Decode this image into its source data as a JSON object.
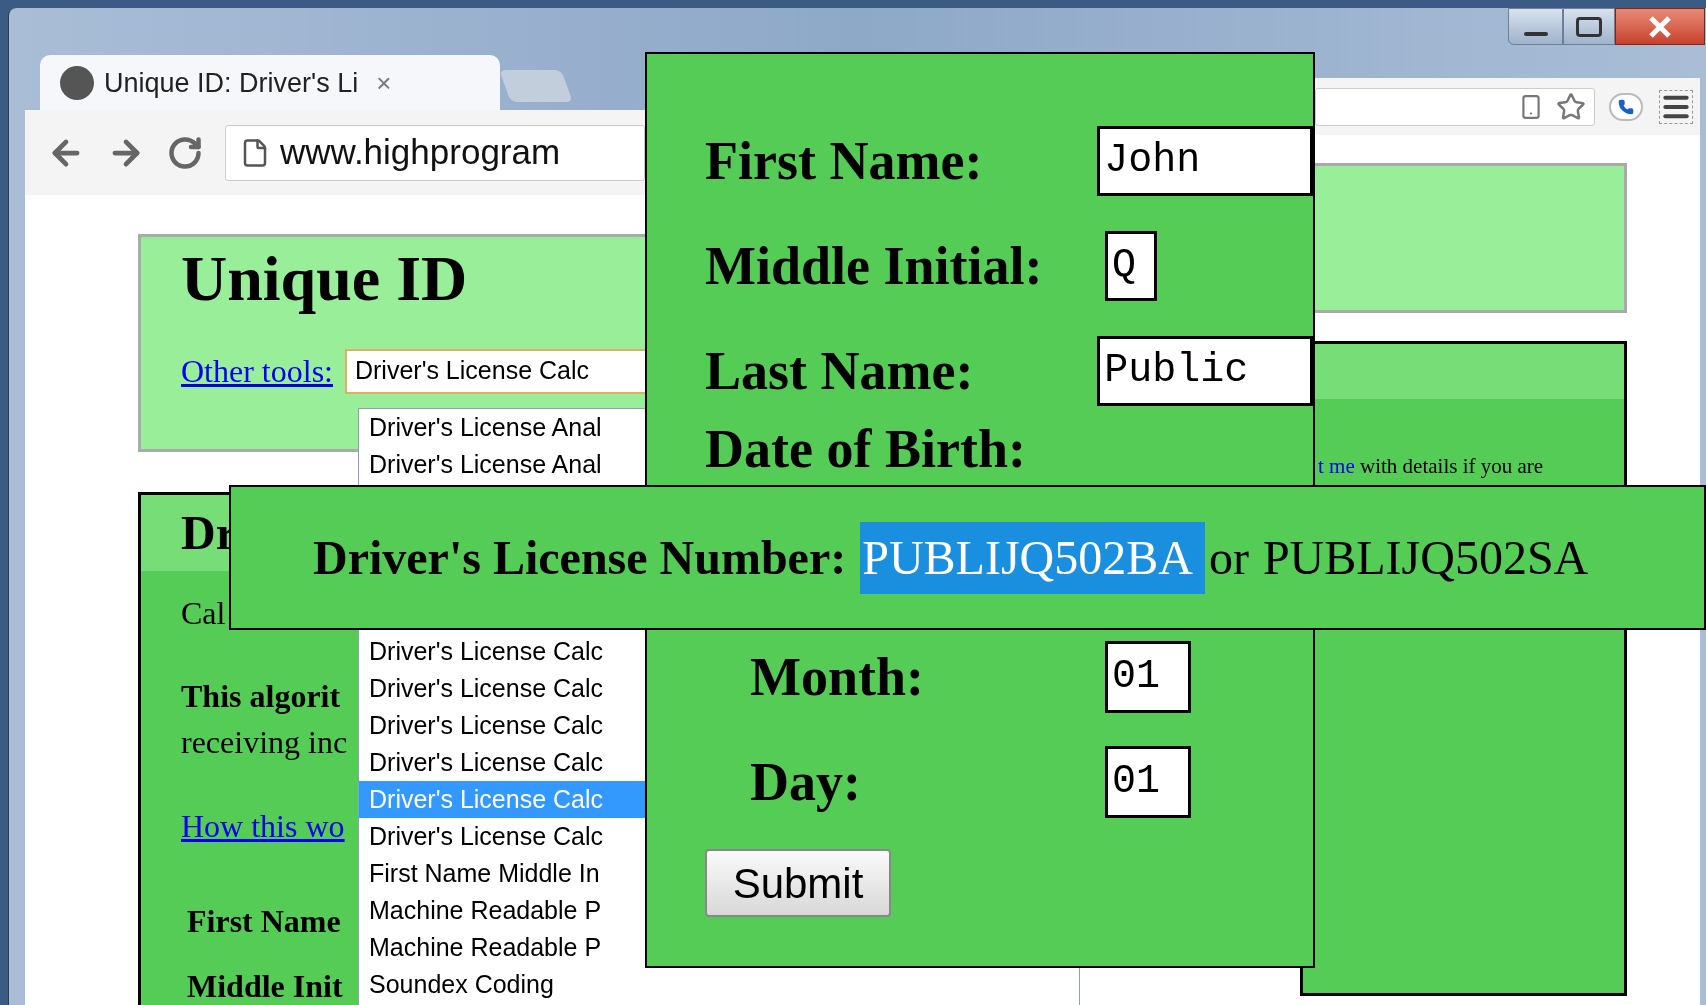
{
  "browser": {
    "tab_title": "Unique ID: Driver's Li",
    "tab_close": "×",
    "address": "www.highprogram"
  },
  "page": {
    "title": "Unique ID",
    "other_tools_link": "Other tools:",
    "tool_select_value": "Driver's License Calc",
    "options_upper": [
      {
        "label": "Driver's License Anal",
        "selected": false
      },
      {
        "label": "Driver's License Anal",
        "selected": false
      }
    ],
    "options_lower": [
      {
        "label": "Driver's License Calc",
        "selected": false
      },
      {
        "label": "Driver's License Calc",
        "selected": false
      },
      {
        "label": "Driver's License Calc",
        "selected": false
      },
      {
        "label": "Driver's License Calc",
        "selected": false
      },
      {
        "label": "Driver's License Calc",
        "selected": true
      },
      {
        "label": "Driver's License Calc",
        "selected": false
      },
      {
        "label": "First Name Middle In",
        "selected": false
      },
      {
        "label": "Machine Readable P",
        "selected": false
      },
      {
        "label": "Machine Readable P",
        "selected": false
      },
      {
        "label": "Soundex Coding",
        "selected": false
      }
    ],
    "section_heading": "Dr",
    "intro": "Cal",
    "algorithm_bold": "This algorit",
    "algorithm_text": "receiving inc",
    "how_link": "How this wo",
    "first_name_label": "First Name",
    "middle_label": "Middle Init",
    "contact_link": "t me",
    "contact_text": "with details if you are"
  },
  "form": {
    "fields": [
      {
        "label": "First Name:",
        "value": "John",
        "kind": "wide"
      },
      {
        "label": "Middle Initial:",
        "value": "Q",
        "kind": "narrow"
      },
      {
        "label": "Last Name:",
        "value": "Public",
        "kind": "wide"
      }
    ],
    "dob_label": "Date of Birth:",
    "date_fields": [
      {
        "label": "Month:",
        "value": "01"
      },
      {
        "label": "Day:",
        "value": "01"
      }
    ],
    "submit": "Submit"
  },
  "result": {
    "label": "Driver's License Number:",
    "number": "PUBLIJQ502BA",
    "separator": "or",
    "alternate": "PUBLIJQ502SA"
  }
}
